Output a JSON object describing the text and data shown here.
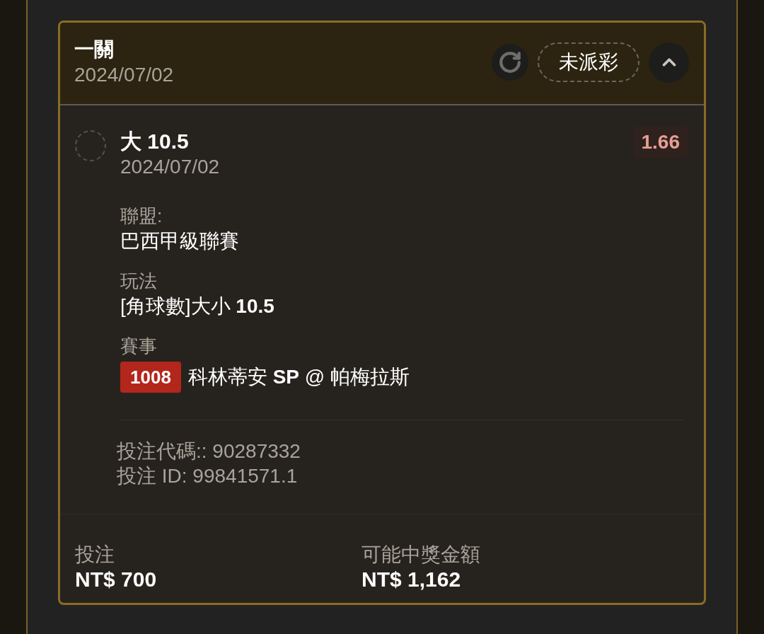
{
  "bet_card": {
    "title": "一關",
    "date": "2024/07/02",
    "status": "未派彩",
    "expanded": true,
    "selection": {
      "selected": false,
      "name": "大 10.5",
      "date": "2024/07/02",
      "odds": "1.66"
    },
    "details": [
      {
        "label": "聯盟:",
        "value": "巴西甲級聯賽"
      },
      {
        "label": "玩法",
        "value": "[角球數]大小 **10.5**"
      },
      {
        "label": "賽事",
        "match_number": "1008",
        "value": "科林蒂安 **SP** @ 帕梅拉斯"
      }
    ],
    "bet_code": "投注代碼:: 90287332",
    "bet_id": "投注 ID: 99841571.1",
    "footer": [
      {
        "label": "投注",
        "value": "NT$ 700"
      },
      {
        "label": "可能中獎金額",
        "value": "NT$ 1,162"
      }
    ]
  }
}
